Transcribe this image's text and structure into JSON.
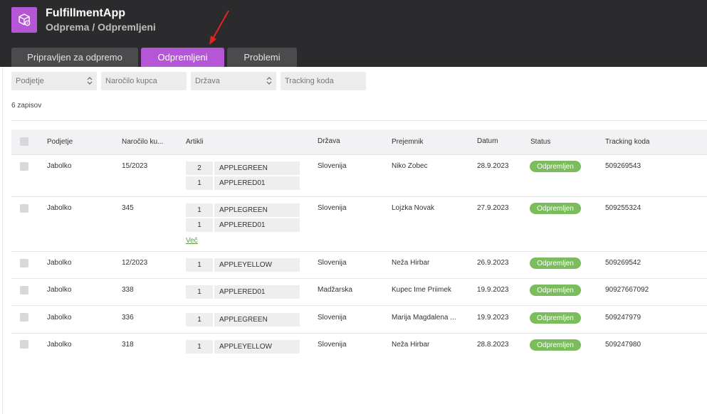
{
  "app": {
    "title": "FulfillmentApp",
    "breadcrumb": "Odprema / Odpremljeni",
    "logo_icon": "box-gear-icon"
  },
  "tabs": [
    {
      "label": "Pripravljen za odpremo",
      "active": false
    },
    {
      "label": "Odpremljeni",
      "active": true
    },
    {
      "label": "Problemi",
      "active": false
    }
  ],
  "filters": {
    "company": {
      "placeholder": "Podjetje"
    },
    "order": {
      "placeholder": "Naročilo kupca"
    },
    "country": {
      "placeholder": "Država"
    },
    "tracking": {
      "placeholder": "Tracking koda"
    }
  },
  "record_count": "6 zapisov",
  "table": {
    "headers": [
      "Podjetje",
      "Naročilo ku...",
      "Artikli",
      "Država",
      "Prejemnik",
      "Datum",
      "Status",
      "Tracking koda"
    ],
    "rows": [
      {
        "company": "Jabolko",
        "order": "15/2023",
        "items": [
          {
            "qty": "2",
            "name": "APPLEGREEN"
          },
          {
            "qty": "1",
            "name": "APPLERED01"
          }
        ],
        "more": "",
        "country": "Slovenija",
        "recipient": "Niko Zobec",
        "date": "28.9.2023",
        "status": "Odpremljen",
        "tracking": "509269543"
      },
      {
        "company": "Jabolko",
        "order": "345",
        "items": [
          {
            "qty": "1",
            "name": "APPLEGREEN"
          },
          {
            "qty": "1",
            "name": "APPLERED01"
          }
        ],
        "more": "Več",
        "country": "Slovenija",
        "recipient": "Lojzka Novak",
        "date": "27.9.2023",
        "status": "Odpremljen",
        "tracking": "509255324"
      },
      {
        "company": "Jabolko",
        "order": "12/2023",
        "items": [
          {
            "qty": "1",
            "name": "APPLEYELLOW"
          }
        ],
        "more": "",
        "country": "Slovenija",
        "recipient": "Neža Hirbar",
        "date": "26.9.2023",
        "status": "Odpremljen",
        "tracking": "509269542"
      },
      {
        "company": "Jabolko",
        "order": "338",
        "items": [
          {
            "qty": "1",
            "name": "APPLERED01"
          }
        ],
        "more": "",
        "country": "Madžarska",
        "recipient": "Kupec Ime Priimek",
        "date": "19.9.2023",
        "status": "Odpremljen",
        "tracking": "90927667092"
      },
      {
        "company": "Jabolko",
        "order": "336",
        "items": [
          {
            "qty": "1",
            "name": "APPLEGREEN"
          }
        ],
        "more": "",
        "country": "Slovenija",
        "recipient": "Marija Magdalena ...",
        "date": "19.9.2023",
        "status": "Odpremljen",
        "tracking": "509247979"
      },
      {
        "company": "Jabolko",
        "order": "318",
        "items": [
          {
            "qty": "1",
            "name": "APPLEYELLOW"
          }
        ],
        "more": "",
        "country": "Slovenija",
        "recipient": "Neža Hirbar",
        "date": "28.8.2023",
        "status": "Odpremljen",
        "tracking": "509247980"
      }
    ]
  },
  "colors": {
    "header_bg": "#2b2b2d",
    "accent": "#b456d6",
    "tab_inactive": "#4b4b4d",
    "status_green": "#7bbd5c",
    "arrow_red": "#e0261f"
  }
}
